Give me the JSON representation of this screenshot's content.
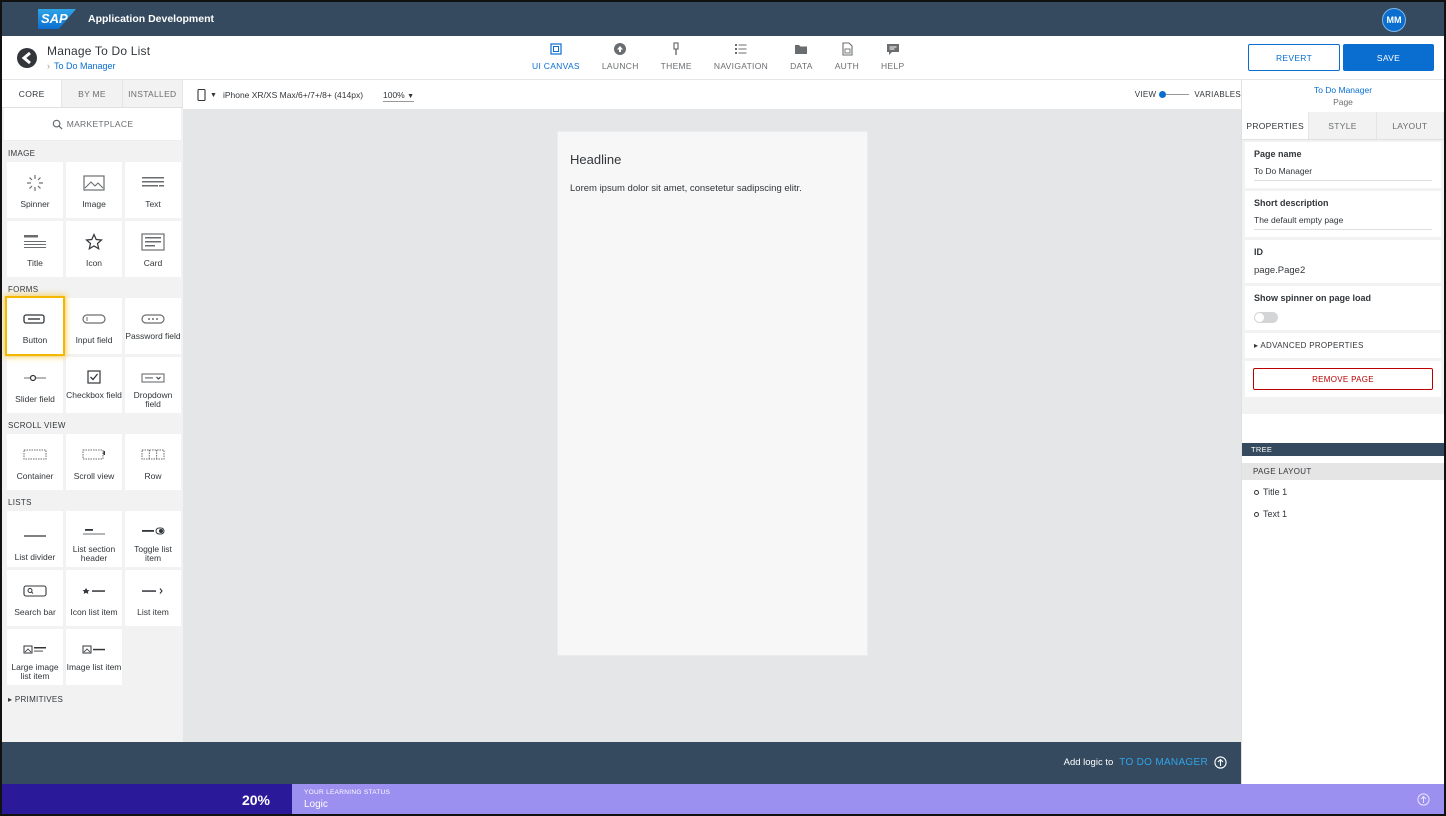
{
  "shell": {
    "logo": "SAP",
    "title": "Application Development",
    "avatar": "MM"
  },
  "project": {
    "title": "Manage To Do List",
    "breadcrumb": "To Do Manager"
  },
  "nav": [
    {
      "label": "UI CANVAS",
      "icon": "canvas-icon",
      "active": true
    },
    {
      "label": "LAUNCH",
      "icon": "launch-icon"
    },
    {
      "label": "THEME",
      "icon": "theme-icon"
    },
    {
      "label": "NAVIGATION",
      "icon": "navigation-icon"
    },
    {
      "label": "DATA",
      "icon": "folder-icon"
    },
    {
      "label": "AUTH",
      "icon": "auth-icon"
    },
    {
      "label": "HELP",
      "icon": "help-icon"
    }
  ],
  "actions": {
    "revert": "REVERT",
    "save": "SAVE"
  },
  "palette": {
    "tabs": [
      "CORE",
      "BY ME",
      "INSTALLED"
    ],
    "marketplace": "MARKETPLACE",
    "sections": {
      "image": "IMAGE",
      "forms": "FORMS",
      "scroll": "SCROLL VIEW",
      "lists": "LISTS",
      "primitives": "PRIMITIVES"
    },
    "image_items": [
      "Spinner",
      "Image",
      "Text",
      "Title",
      "Icon",
      "Card"
    ],
    "form_items": [
      "Button",
      "Input field",
      "Password field",
      "Slider field",
      "Checkbox field",
      "Dropdown field"
    ],
    "scroll_items": [
      "Container",
      "Scroll view",
      "Row"
    ],
    "list_items": [
      "List divider",
      "List section header",
      "Toggle list item",
      "Search bar",
      "Icon list item",
      "List item",
      "Large image list item",
      "Image list item"
    ]
  },
  "toolbar": {
    "device": "iPhone XR/XS Max/6+/7+/8+ (414px)",
    "zoom": "100%",
    "view": "VIEW",
    "variables": "VARIABLES"
  },
  "canvas": {
    "headline": "Headline",
    "body": "Lorem ipsum dolor sit amet, consetetur sadipscing elitr."
  },
  "logic": {
    "prefix": "Add logic to",
    "target": "TO DO MANAGER"
  },
  "learning": {
    "percent": "20%",
    "label": "YOUR LEARNING STATUS",
    "value": "Logic"
  },
  "properties": {
    "header_title": "To Do Manager",
    "header_sub": "Page",
    "tabs": [
      "PROPERTIES",
      "STYLE",
      "LAYOUT"
    ],
    "page_name_label": "Page name",
    "page_name": "To Do Manager",
    "short_desc_label": "Short description",
    "short_desc": "The default empty page",
    "id_label": "ID",
    "id": "page.Page2",
    "spinner_label": "Show spinner on page load",
    "advanced": "ADVANCED PROPERTIES",
    "remove": "REMOVE PAGE"
  },
  "tree": {
    "title": "TREE",
    "layout": "PAGE LAYOUT",
    "items": [
      "Title 1",
      "Text 1"
    ]
  },
  "colors": {
    "shell": "#354a5f",
    "accent": "#0a6ed1",
    "learn_dark": "#2a1a9a",
    "learn_light": "#9b8ff0",
    "highlight": "#f5b800"
  }
}
